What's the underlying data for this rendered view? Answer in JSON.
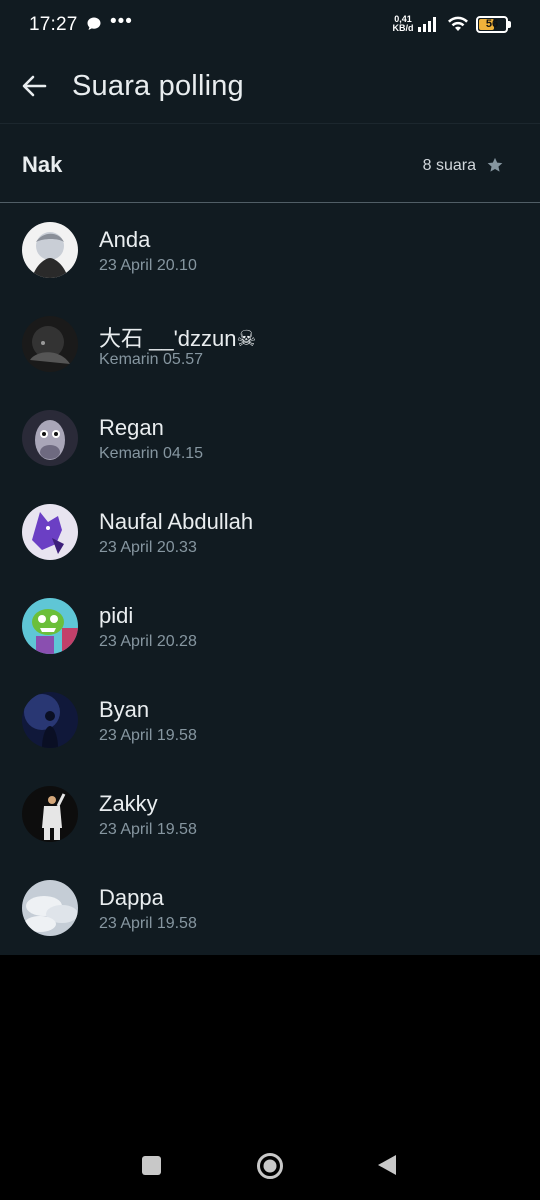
{
  "status_bar": {
    "time": "17:27",
    "dots": "•••",
    "net_speed_value": "0,41",
    "net_speed_unit": "KB/d",
    "battery": "56",
    "icons": [
      "chat-bubble-icon",
      "signal-icon",
      "wifi-icon",
      "battery-icon"
    ]
  },
  "header": {
    "title": "Suara polling",
    "back_icon": "arrow-left-icon"
  },
  "option": {
    "name": "Nak",
    "votes": "8 suara",
    "icon": "star-icon"
  },
  "voters": [
    {
      "name": "Anda",
      "time": "23 April 20.10",
      "avatar_colors": [
        "#f2f2f2",
        "#8a8f98"
      ]
    },
    {
      "name": "大石 __'dzzun☠",
      "time": "Kemarin 05.57",
      "avatar_colors": [
        "#1a1a1a",
        "#555555"
      ]
    },
    {
      "name": "Regan",
      "time": "Kemarin 04.15",
      "avatar_colors": [
        "#2a2a38",
        "#a9a6b8"
      ]
    },
    {
      "name": "Naufal Abdullah",
      "time": "23 April 20.33",
      "avatar_colors": [
        "#e8e4f0",
        "#6b3fc4"
      ]
    },
    {
      "name": "pidi",
      "time": "23 April 20.28",
      "avatar_colors": [
        "#5fc6d6",
        "#6bbf3a"
      ]
    },
    {
      "name": "Byan",
      "time": "23 April 19.58",
      "avatar_colors": [
        "#10183a",
        "#3a4c9a"
      ]
    },
    {
      "name": "Zakky",
      "time": "23 April 19.58",
      "avatar_colors": [
        "#0d0d0d",
        "#e6e6e6"
      ]
    },
    {
      "name": "Dappa",
      "time": "23 April 19.58",
      "avatar_colors": [
        "#c5cdd6",
        "#eef1f4"
      ]
    }
  ],
  "nav": {
    "icons": [
      "recent-apps-icon",
      "home-icon",
      "back-icon"
    ]
  },
  "colors": {
    "background": "#111b21",
    "text_primary": "#e9edef",
    "text_secondary": "#8696a0",
    "battery": "#f0b23a"
  }
}
